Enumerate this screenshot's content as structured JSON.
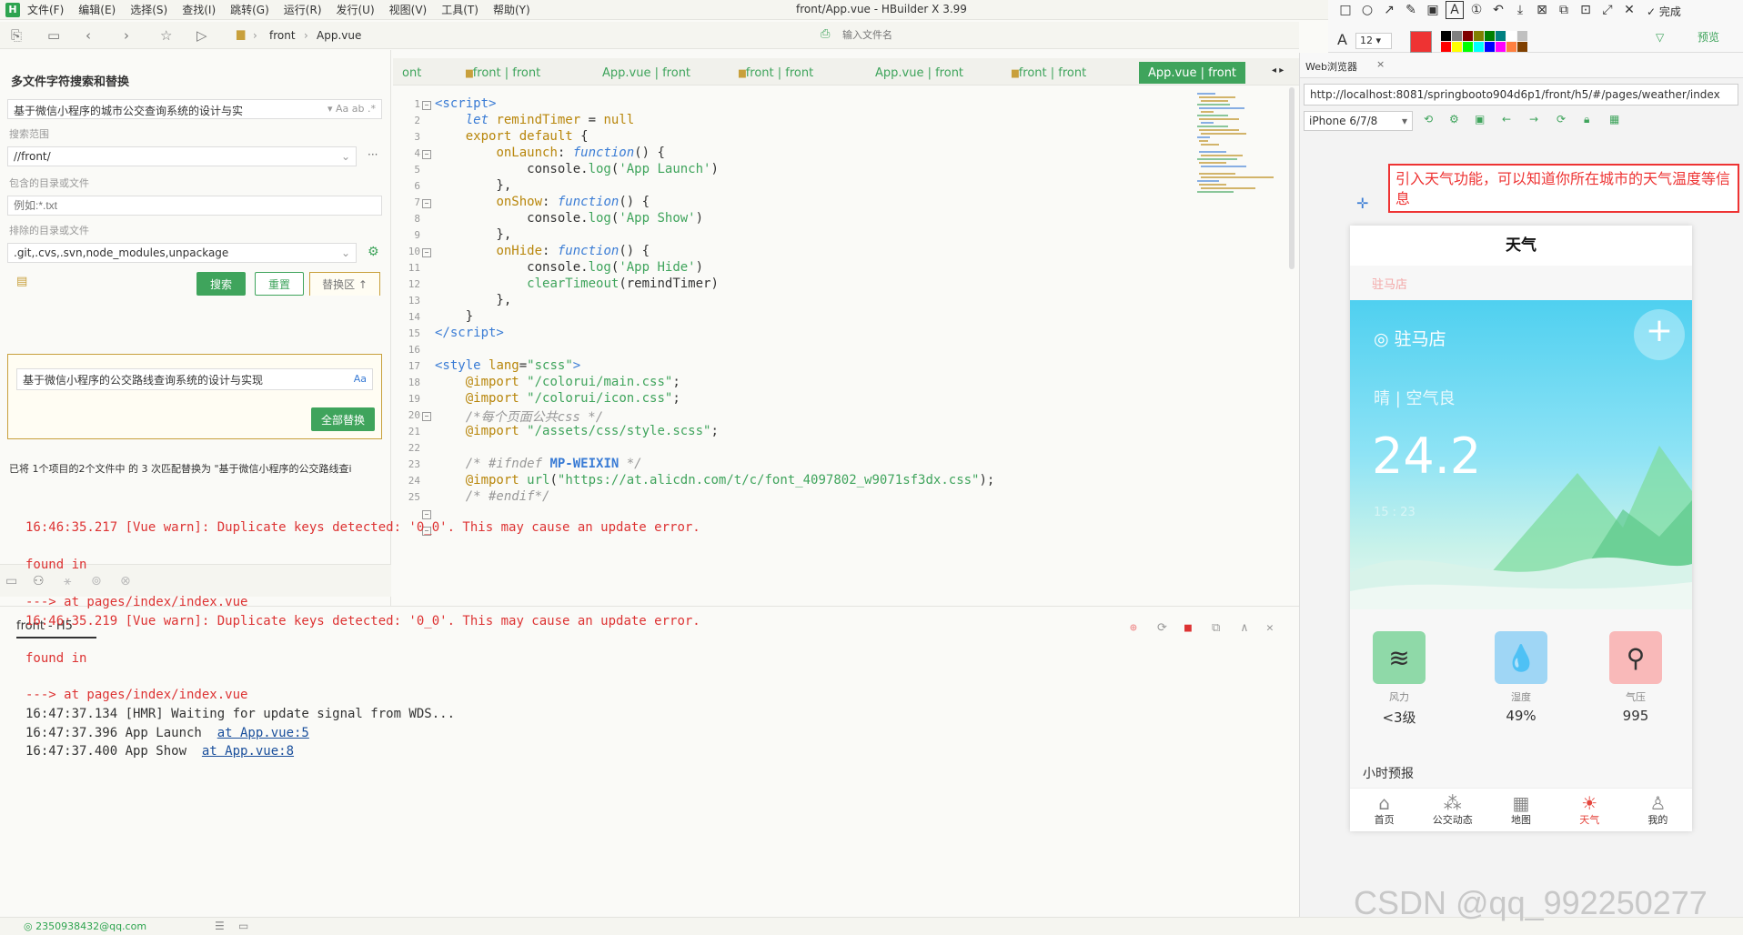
{
  "menubar": {
    "items": [
      "文件(F)",
      "编辑(E)",
      "选择(S)",
      "查找(I)",
      "跳转(G)",
      "运行(R)",
      "发行(U)",
      "视图(V)",
      "工具(T)",
      "帮助(Y)"
    ],
    "title": "front/App.vue - HBuilder X 3.99"
  },
  "annotation_toolbar": {
    "font_size": "12",
    "done_label": "完成",
    "preview_label": "预览",
    "text_tool_letter": "A",
    "colors": [
      "#000000",
      "#808080",
      "#800000",
      "#808000",
      "#008000",
      "#008080",
      "#ffffff",
      "#c0c0c0",
      "#ff0000",
      "#ffff00",
      "#00ff00",
      "#00ffff",
      "#0000ff",
      "#ff00ff",
      "#ff8040",
      "#804000"
    ]
  },
  "toolbar": {
    "breadcrumb_folder": "front",
    "breadcrumb_file": "App.vue",
    "file_input_placeholder": "输入文件名"
  },
  "search_panel": {
    "title": "多文件字符搜索和替换",
    "search_value": "基于微信小程序的城市公交查询系统的设计与实",
    "scope_label": "搜索范围",
    "scope_value": "//front/",
    "include_label": "包含的目录或文件",
    "include_placeholder": "例如:*.txt",
    "exclude_label": "排除的目录或文件",
    "exclude_value": ".git,.cvs,.svn,node_modules,unpackage",
    "search_button": "搜索",
    "reset_button": "重置",
    "replace_toggle": "替换区 ↑",
    "replace_value": "基于微信小程序的公交路线查询系统的设计与实现",
    "replace_all_button": "全部替换",
    "result_text": "已将 1个项目的2个文件中 的 3 次匹配替换为 \"基于微信小程序的公交路线查i"
  },
  "editor_tabs": [
    {
      "label": "ont",
      "active": false,
      "folder": false
    },
    {
      "label": "front | front",
      "active": false,
      "folder": true
    },
    {
      "label": "App.vue | front",
      "active": false,
      "folder": false
    },
    {
      "label": "front | front",
      "active": false,
      "folder": true
    },
    {
      "label": "App.vue | front",
      "active": false,
      "folder": false
    },
    {
      "label": "front | front",
      "active": false,
      "folder": true
    },
    {
      "label": "App.vue | front",
      "active": true,
      "folder": false
    }
  ],
  "editor": {
    "line_numbers": [
      "1",
      "2",
      "3",
      "4",
      "5",
      "6",
      "7",
      "8",
      "9",
      "10",
      "11",
      "12",
      "13",
      "14",
      "15",
      "16",
      "17",
      "18",
      "19",
      "20",
      "21",
      "22",
      "23",
      "24",
      "25"
    ]
  },
  "console": {
    "tab_label": "front - H5",
    "lines": [
      {
        "text": "16:46:35.217 [Vue warn]: Duplicate keys detected: '0_0'. This may cause an update error.",
        "cls": "red"
      },
      {
        "text": "",
        "cls": "dark"
      },
      {
        "text": "found in",
        "cls": "red"
      },
      {
        "text": "",
        "cls": "dark"
      },
      {
        "text": "---> at pages/index/index.vue",
        "cls": "red"
      },
      {
        "text": "16:46:35.219 [Vue warn]: Duplicate keys detected: '0_0'. This may cause an update error.",
        "cls": "red"
      },
      {
        "text": "",
        "cls": "dark"
      },
      {
        "text": "found in",
        "cls": "red"
      },
      {
        "text": "",
        "cls": "dark"
      },
      {
        "text": "---> at pages/index/index.vue",
        "cls": "red"
      },
      {
        "text": "16:47:37.134 [HMR] Waiting for update signal from WDS...",
        "cls": "dark"
      },
      {
        "text": "16:47:37.396 App Launch  ",
        "cls": "dark",
        "link": "at App.vue:5"
      },
      {
        "text": "16:47:37.400 App Show  ",
        "cls": "dark",
        "link": "at App.vue:8"
      }
    ]
  },
  "statusbar": {
    "account": "2350938432@qq.com"
  },
  "webpanel": {
    "tab_label": "Web浏览器",
    "url": "http://localhost:8081/springbooto904d6p1/front/h5/#/pages/weather/index",
    "device": "iPhone 6/7/8"
  },
  "note": {
    "text": "引入天气功能，可以知道你所在城市的天气温度等信息"
  },
  "phone": {
    "title": "天气",
    "sub_location": "驻马店",
    "location": "驻马店",
    "condition": "晴 | 空气良",
    "temperature": "24.2",
    "date_faint": "15 : 23",
    "stats": [
      {
        "icon": "wind-icon",
        "label": "风力",
        "value": "<3级",
        "color": "#8fd9a8",
        "glyph": "≋"
      },
      {
        "icon": "humidity-icon",
        "label": "湿度",
        "value": "49%",
        "color": "#9fd6f5",
        "glyph": "💧"
      },
      {
        "icon": "pressure-icon",
        "label": "气压",
        "value": "995",
        "color": "#f9b9b9",
        "glyph": "⚲"
      }
    ],
    "hourly_label": "小时预报",
    "nav": [
      {
        "label": "首页",
        "icon": "home-icon",
        "glyph": "⌂",
        "active": false
      },
      {
        "label": "公交动态",
        "icon": "bus-dynamics-icon",
        "glyph": "⁂",
        "active": false
      },
      {
        "label": "地图",
        "icon": "map-icon",
        "glyph": "▦",
        "active": false
      },
      {
        "label": "天气",
        "icon": "weather-icon",
        "glyph": "☀",
        "active": true
      },
      {
        "label": "我的",
        "icon": "user-icon",
        "glyph": "♙",
        "active": false
      }
    ]
  },
  "watermark": {
    "text": "CSDN @qq_992250277"
  }
}
